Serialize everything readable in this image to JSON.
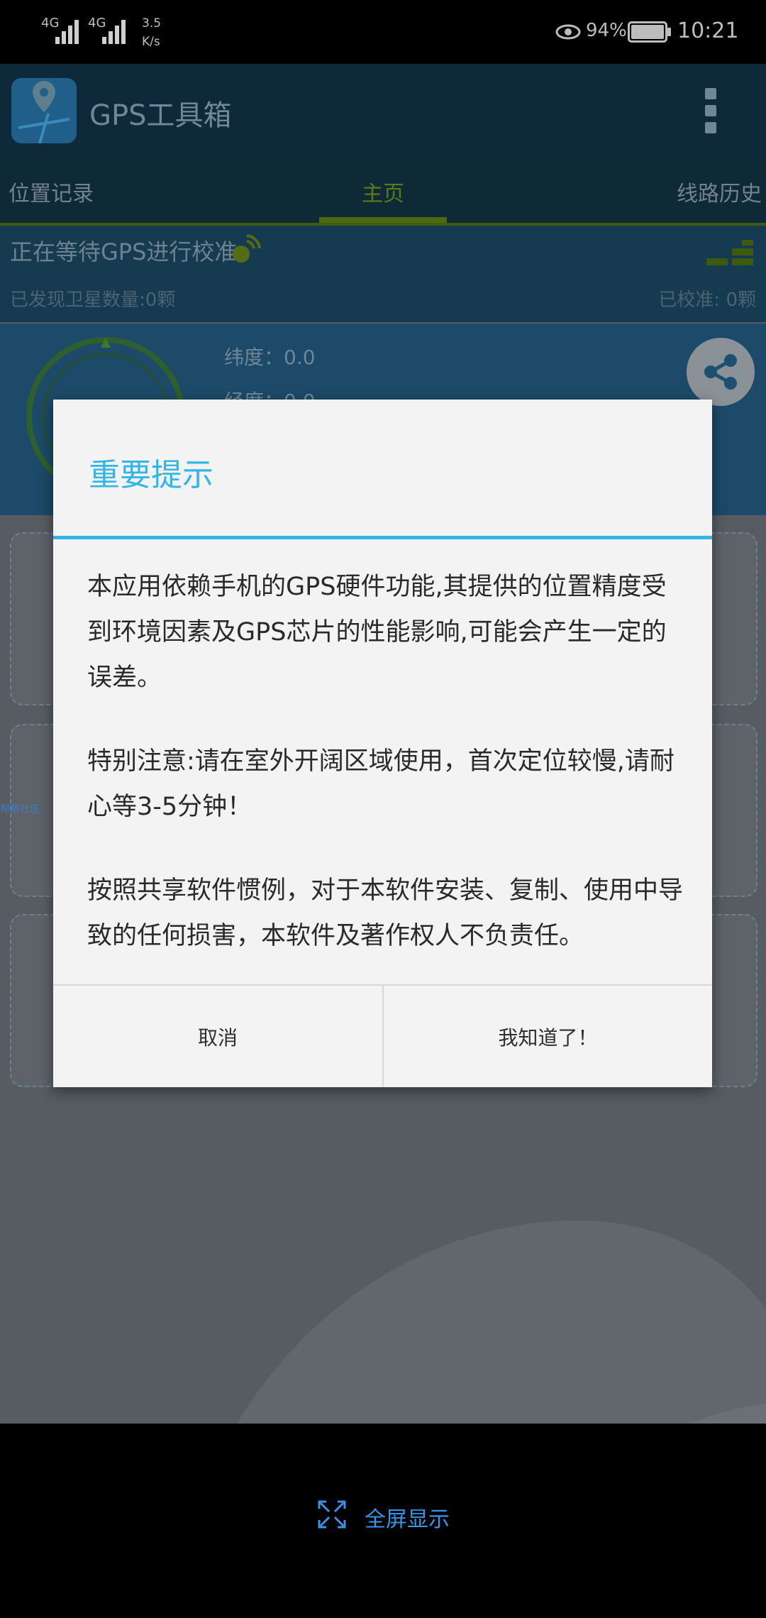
{
  "status_bar": {
    "signal_1_label": "4G",
    "signal_2_label": "4G",
    "net_speed_value": "3.5",
    "net_speed_unit": "K/s",
    "battery_percent": "94%",
    "time": "10:21"
  },
  "app": {
    "title": "GPS工具箱",
    "tabs": [
      {
        "label": "位置记录"
      },
      {
        "label": "主页"
      },
      {
        "label": "线路历史"
      }
    ],
    "gps_status": "正在等待GPS进行校准",
    "satellites_found": "已发现卫星数量:0颗",
    "calibrated": "已校准: 0颗",
    "latitude": "纬度：0.0",
    "longitude": "经度：0.0",
    "side_link": "帮帮社区",
    "fullscreen_label": "全屏显示"
  },
  "dialog": {
    "title": "重要提示",
    "paragraph_1": "本应用依赖手机的GPS硬件功能,其提供的位置精度受到环境因素及GPS芯片的性能影响,可能会产生一定的误差。",
    "paragraph_2": "特别注意:请在室外开阔区域使用，首次定位较慢,请耐心等3-5分钟！",
    "paragraph_3": "按照共享软件惯例，对于本软件安装、复制、使用中导致的任何损害，本软件及著作权人不负责任。",
    "cancel_label": "取消",
    "ok_label": "我知道了！"
  },
  "colors": {
    "accent": "#33b5e5",
    "fullscreen_blue": "#3b93e3"
  }
}
